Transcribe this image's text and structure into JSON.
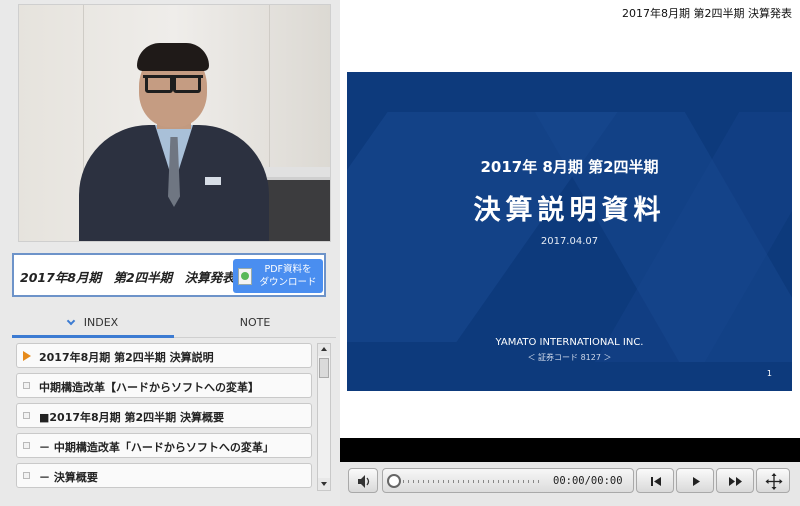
{
  "event_title": "2017年8月期 第2四半期 決算発表",
  "sidebar": {
    "session_title": "2017年8月期　第2四半期　決算発表",
    "pdf_button_label": "PDF資料を\nダウンロード",
    "tabs": [
      {
        "label": "INDEX",
        "active": true
      },
      {
        "label": "NOTE",
        "active": false
      }
    ],
    "index_items": [
      {
        "label": "2017年8月期 第2四半期 決算説明",
        "active": true
      },
      {
        "label": "中期構造改革【ハードからソフトへの変革】",
        "active": false
      },
      {
        "label": "■2017年8月期 第2四半期 決算概要",
        "active": false
      },
      {
        "label": "－ 中期構造改革「ハードからソフトへの変革」",
        "active": false
      },
      {
        "label": "－ 決算概要",
        "active": false
      }
    ]
  },
  "slide": {
    "subtitle": "2017年 8月期 第2四半期",
    "title": "決算説明資料",
    "date": "2017.04.07",
    "company": "YAMATO INTERNATIONAL INC.",
    "code": "＜ 証券コード 8127 ＞",
    "page_number": "1"
  },
  "player": {
    "time": "00:00/00:00",
    "progress": 0,
    "icons": {
      "volume": "speaker-icon",
      "prev": "skip-previous-icon",
      "play": "play-icon",
      "forward": "fast-forward-icon",
      "fullscreen": "fullscreen-icon"
    }
  },
  "colors": {
    "slide_bg": "#0d3a7c",
    "accent": "#3c7bd2",
    "pdf_button": "#4a8ef0",
    "active_marker": "#e68a1a"
  }
}
